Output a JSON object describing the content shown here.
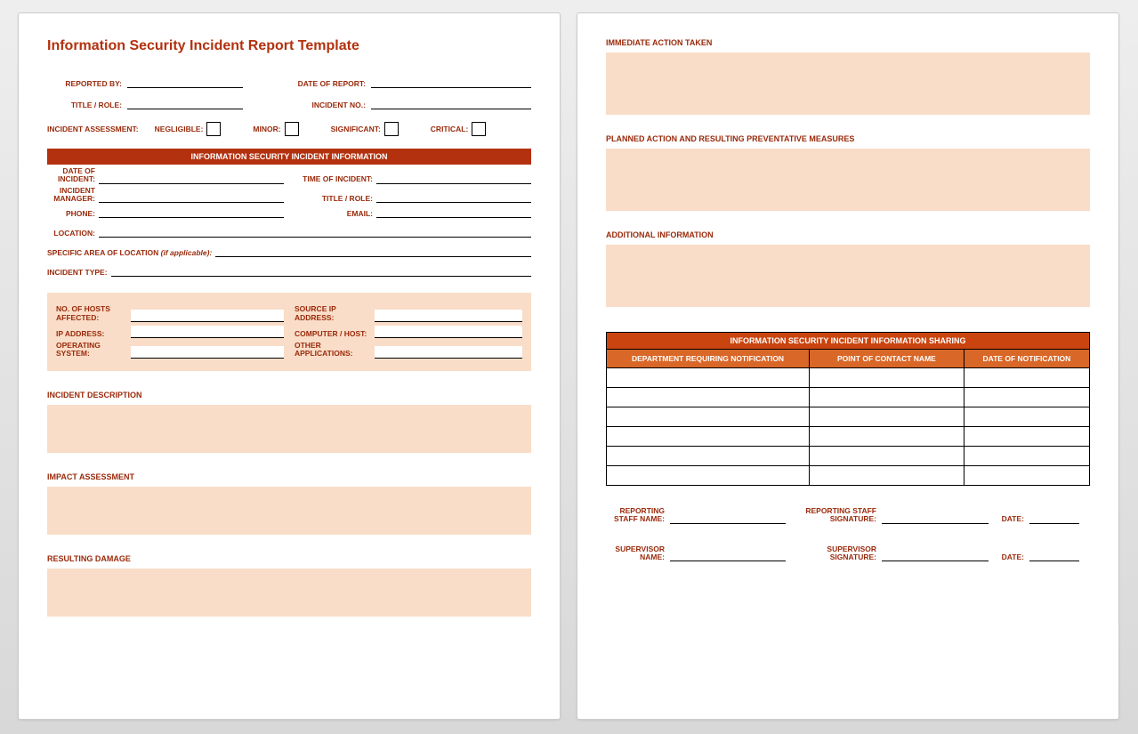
{
  "title": "Information Security Incident Report Template",
  "header": {
    "reported_by": "REPORTED BY:",
    "date_of_report": "DATE OF REPORT:",
    "title_role": "TITLE / ROLE:",
    "incident_no": "INCIDENT NO.:"
  },
  "assessment": {
    "label": "INCIDENT ASSESSMENT:",
    "negligible": "NEGLIGIBLE:",
    "minor": "MINOR:",
    "significant": "SIGNIFICANT:",
    "critical": "CRITICAL:"
  },
  "info_bar": "INFORMATION SECURITY INCIDENT INFORMATION",
  "info": {
    "date_of_incident": "DATE OF INCIDENT:",
    "time_of_incident": "TIME OF INCIDENT:",
    "incident_manager": "INCIDENT MANAGER:",
    "title_role": "TITLE / ROLE:",
    "phone": "PHONE:",
    "email": "EMAIL:",
    "location": "LOCATION:",
    "specific_area": "SPECIFIC AREA OF LOCATION",
    "if_applicable": "(if applicable):",
    "incident_type": "INCIDENT TYPE:"
  },
  "tech": {
    "hosts_affected": "NO. OF HOSTS AFFECTED:",
    "source_ip": "SOURCE IP ADDRESS:",
    "ip_address": "IP ADDRESS:",
    "computer_host": "COMPUTER / HOST:",
    "operating_system": "OPERATING SYSTEM:",
    "other_apps": "OTHER APPLICATIONS:"
  },
  "sections": {
    "incident_description": "INCIDENT DESCRIPTION",
    "impact_assessment": "IMPACT ASSESSMENT",
    "resulting_damage": "RESULTING DAMAGE",
    "immediate_action": "IMMEDIATE ACTION TAKEN",
    "planned_action": "PLANNED ACTION AND RESULTING PREVENTATIVE MEASURES",
    "additional_info": "ADDITIONAL INFORMATION"
  },
  "sharing": {
    "header": "INFORMATION SECURITY INCIDENT INFORMATION SHARING",
    "col1": "DEPARTMENT REQUIRING NOTIFICATION",
    "col2": "POINT OF CONTACT NAME",
    "col3": "DATE OF NOTIFICATION"
  },
  "signatures": {
    "reporting_staff_name": "REPORTING STAFF NAME:",
    "reporting_staff_sig": "REPORTING STAFF SIGNATURE:",
    "supervisor_name": "SUPERVISOR NAME:",
    "supervisor_sig": "SUPERVISOR SIGNATURE:",
    "date": "DATE:"
  }
}
